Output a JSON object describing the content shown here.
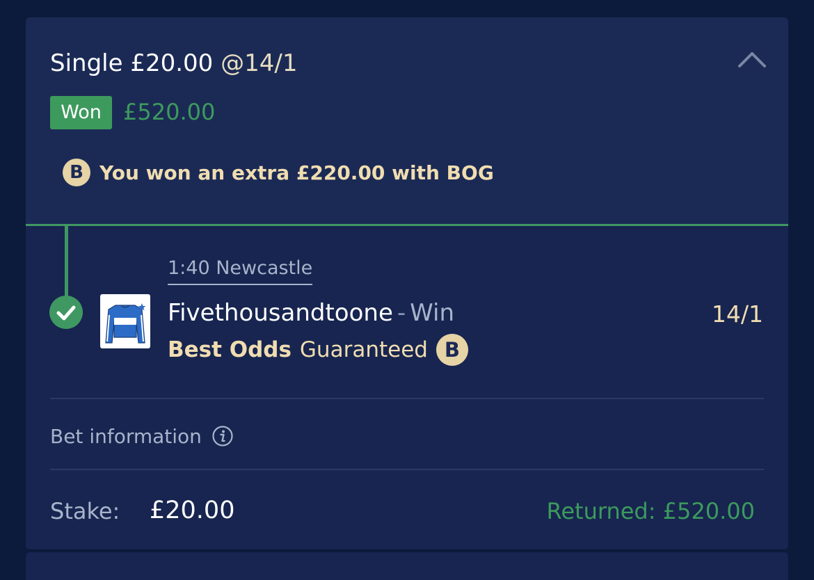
{
  "bet": {
    "type_label": "Single £20.00",
    "odds_label": "@14/1",
    "status": "Won",
    "won_amount": "£520.00",
    "bog_message": "You won an extra £220.00 with BOG",
    "bog_badge": "B",
    "collapse_icon": "chevron-up-icon"
  },
  "selection": {
    "race": "1:40 Newcastle",
    "horse": "Fivethousandtoone",
    "separator": "-",
    "market": "Win",
    "odds": "14/1",
    "bog_strong": "Best Odds",
    "bog_rest": "Guaranteed",
    "bog_badge": "B",
    "result_icon": "check-icon",
    "silk_icon": "jockey-silk-icon"
  },
  "bet_information": {
    "label": "Bet information",
    "icon": "info-icon"
  },
  "summary": {
    "stake_label": "Stake:",
    "stake_value": "£20.00",
    "returned": "Returned: £520.00"
  },
  "colors": {
    "background": "#0c1a3b",
    "card": "#172550",
    "card_header": "#1b2a55",
    "won_green": "#3d9a5d",
    "bog_gold": "#f0ddb0"
  }
}
